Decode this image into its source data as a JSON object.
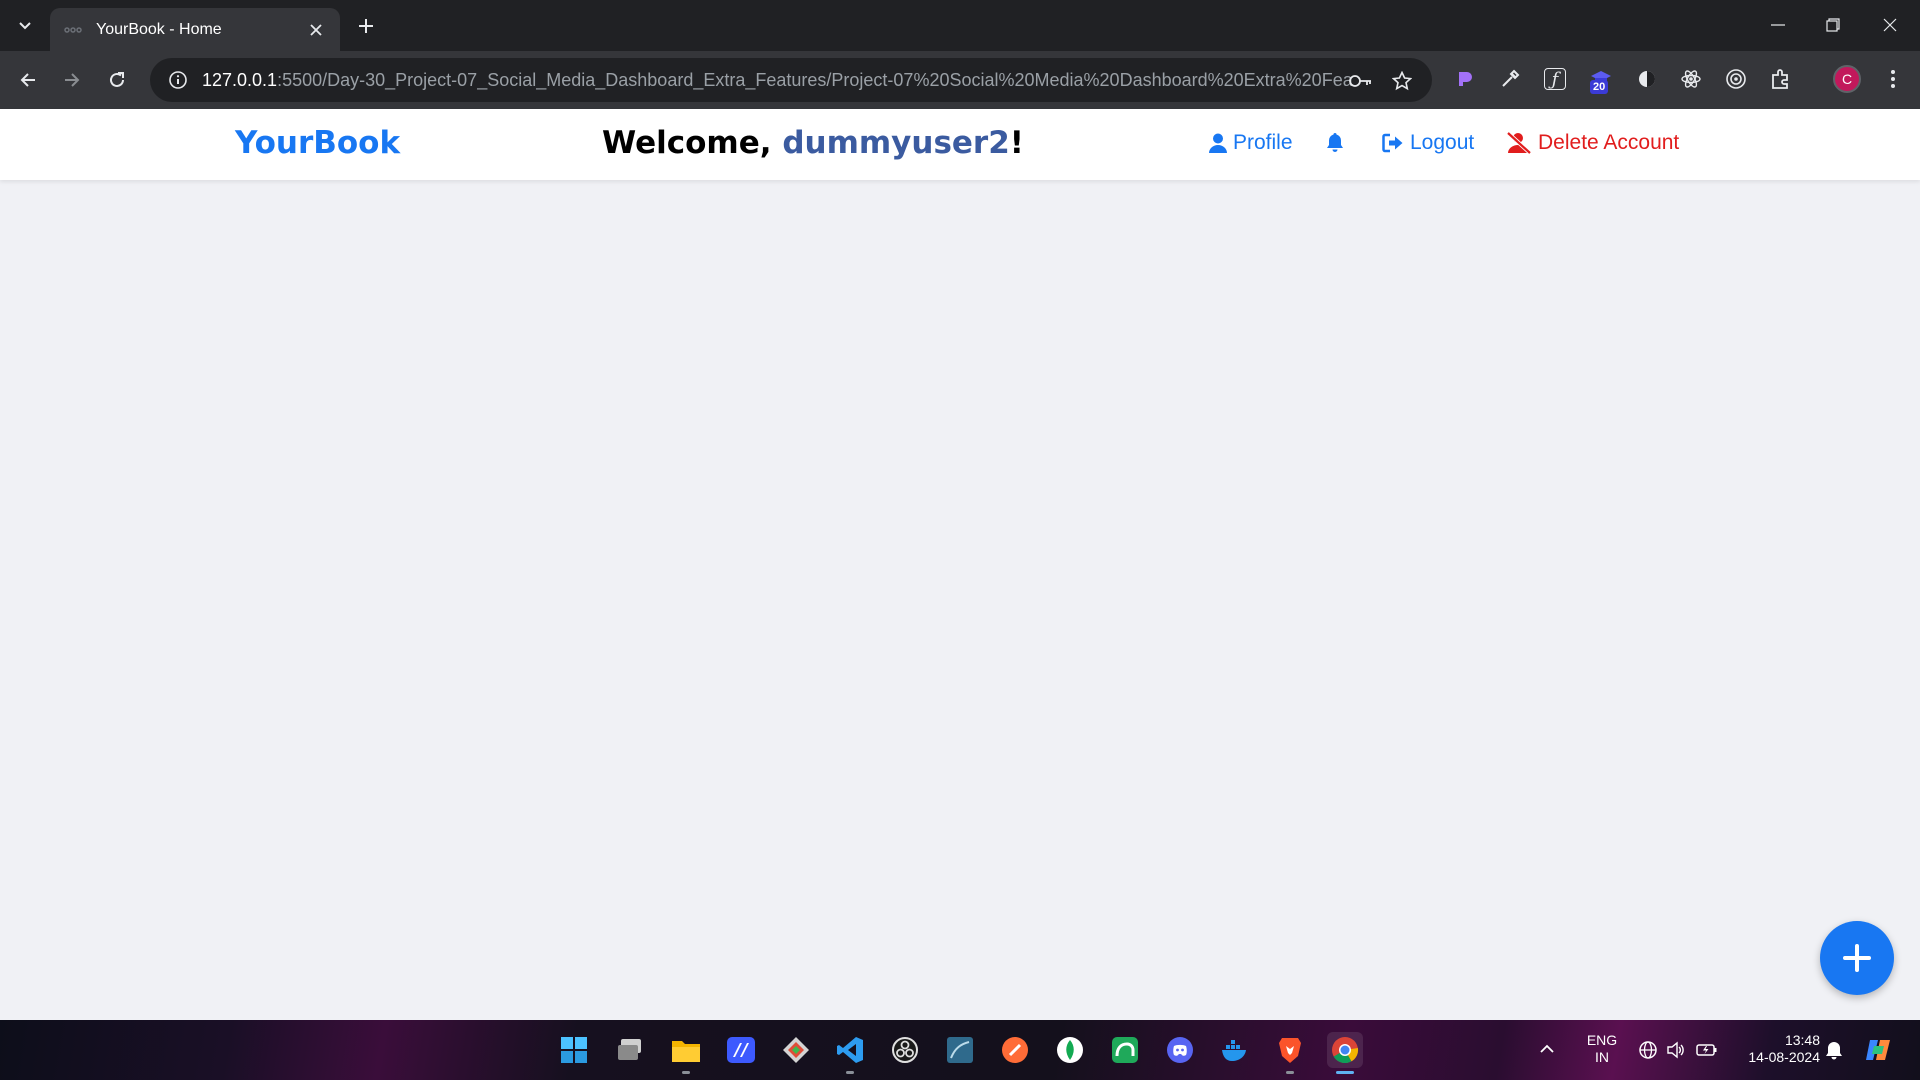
{
  "browser": {
    "tab": {
      "title": "YourBook - Home"
    },
    "omnibox": {
      "url_host": "127.0.0.1",
      "url_rest": ":5500/Day-30_Project-07_Social_Media_Dashboard_Extra_Features/Project-07%20Social%20Media%20Dashboard%20Extra%20Features/d..."
    },
    "extension_badge": "20",
    "profile_initial": "C"
  },
  "app": {
    "brand": "YourBook",
    "welcome_prefix": "Welcome, ",
    "username": "dummyuser2",
    "welcome_suffix": "!",
    "nav": {
      "profile": "Profile",
      "logout": "Logout",
      "delete_account": "Delete Account"
    },
    "colors": {
      "primary": "#1877f2",
      "danger": "#e11d1d",
      "username": "#3b5ba0"
    }
  },
  "taskbar": {
    "lang_line1": "ENG",
    "lang_line2": "IN",
    "time": "13:48",
    "date": "14-08-2024"
  }
}
